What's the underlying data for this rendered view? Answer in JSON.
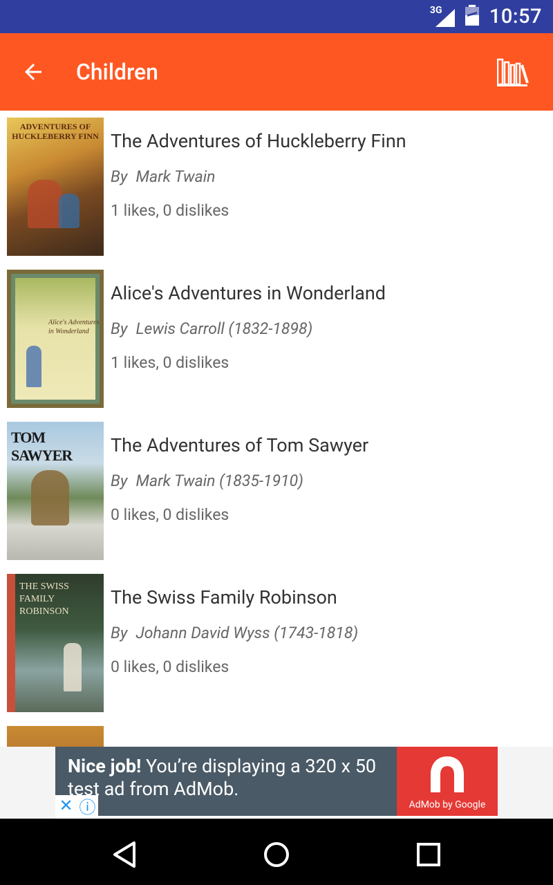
{
  "status": {
    "network_label": "3G",
    "time": "10:57"
  },
  "app_bar": {
    "title": "Children",
    "back_icon": "arrow-back-icon",
    "library_icon": "library-books-icon"
  },
  "colors": {
    "status_bar": "#303f9f",
    "app_bar": "#ff5722",
    "ad_bg": "#4a5a66",
    "ad_logo": "#e53935"
  },
  "books": [
    {
      "title": "The Adventures of Huckleberry Finn",
      "by": "By",
      "author": "Mark Twain",
      "likes": "1 likes, 0 dislikes",
      "cover_text": "ADVENTURES OF HUCKLEBERRY FINN"
    },
    {
      "title": "Alice's Adventures in Wonderland",
      "by": "By",
      "author": "Lewis Carroll (1832-1898)",
      "likes": "1 likes, 0 dislikes",
      "cover_text": "Alice's Adventures in Wonderland"
    },
    {
      "title": "The Adventures of Tom Sawyer",
      "by": "By",
      "author": "Mark Twain (1835-1910)",
      "likes": "0 likes, 0 dislikes",
      "cover_text": "TOM SAWYER"
    },
    {
      "title": "The Swiss Family Robinson",
      "by": "By",
      "author": "Johann David Wyss (1743-1818)",
      "likes": "0 likes, 0 dislikes",
      "cover_text": "THE SWISS FAMILY ROBINSON"
    }
  ],
  "ad": {
    "headline": "Nice job!",
    "body": " You’re displaying a 320 x 50 test ad from AdMob.",
    "brand": "AdMob by Google"
  },
  "nav": {
    "back_icon": "nav-back-icon",
    "home_icon": "nav-home-icon",
    "recents_icon": "nav-recents-icon"
  }
}
